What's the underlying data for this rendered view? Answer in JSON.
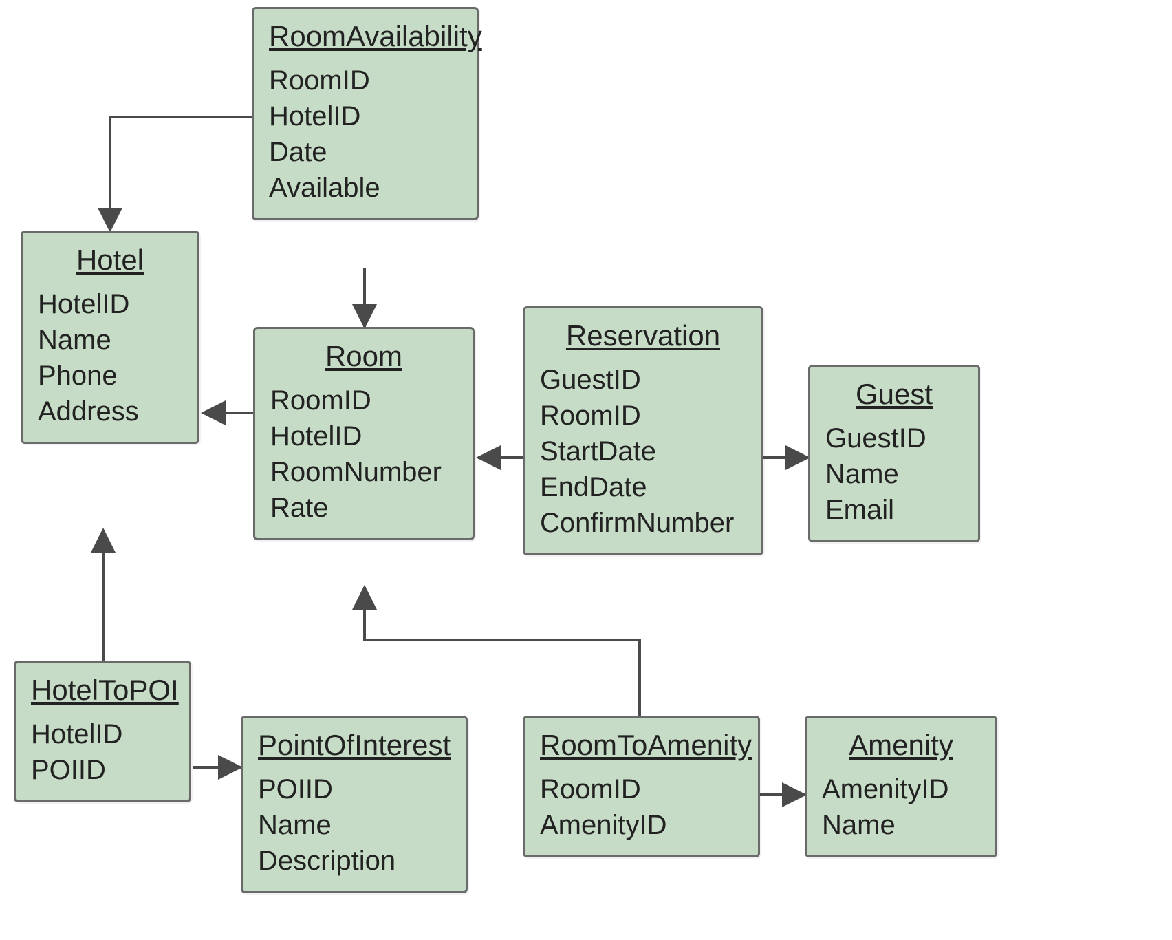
{
  "entities": {
    "roomAvailability": {
      "title": "RoomAvailability",
      "attrs": [
        "RoomID",
        "HotelID",
        "Date",
        "Available"
      ]
    },
    "hotel": {
      "title": "Hotel",
      "attrs": [
        "HotelID",
        "Name",
        "Phone",
        "Address"
      ]
    },
    "room": {
      "title": "Room",
      "attrs": [
        "RoomID",
        "HotelID",
        "RoomNumber",
        "Rate"
      ]
    },
    "reservation": {
      "title": "Reservation",
      "attrs": [
        "GuestID",
        "RoomID",
        "StartDate",
        "EndDate",
        "ConfirmNumber"
      ]
    },
    "guest": {
      "title": "Guest",
      "attrs": [
        "GuestID",
        "Name",
        "Email"
      ]
    },
    "hotelToPOI": {
      "title": "HotelToPOI",
      "attrs": [
        "HotelID",
        "POIID"
      ]
    },
    "pointOfInterest": {
      "title": "PointOfInterest",
      "attrs": [
        "POIID",
        "Name",
        "Description"
      ]
    },
    "roomToAmenity": {
      "title": "RoomToAmenity",
      "attrs": [
        "RoomID",
        "AmenityID"
      ]
    },
    "amenity": {
      "title": "Amenity",
      "attrs": [
        "AmenityID",
        "Name"
      ]
    }
  },
  "relationships": [
    {
      "from": "RoomAvailability",
      "to": "Hotel"
    },
    {
      "from": "RoomAvailability",
      "to": "Room"
    },
    {
      "from": "Room",
      "to": "Hotel"
    },
    {
      "from": "Reservation",
      "to": "Room"
    },
    {
      "from": "Reservation",
      "to": "Guest"
    },
    {
      "from": "HotelToPOI",
      "to": "Hotel"
    },
    {
      "from": "HotelToPOI",
      "to": "PointOfInterest"
    },
    {
      "from": "RoomToAmenity",
      "to": "Room"
    },
    {
      "from": "RoomToAmenity",
      "to": "Amenity"
    }
  ],
  "style": {
    "box_fill": "#c6dcc6",
    "box_stroke": "#6a6a6a",
    "arrow_stroke": "#4a4a4a"
  }
}
